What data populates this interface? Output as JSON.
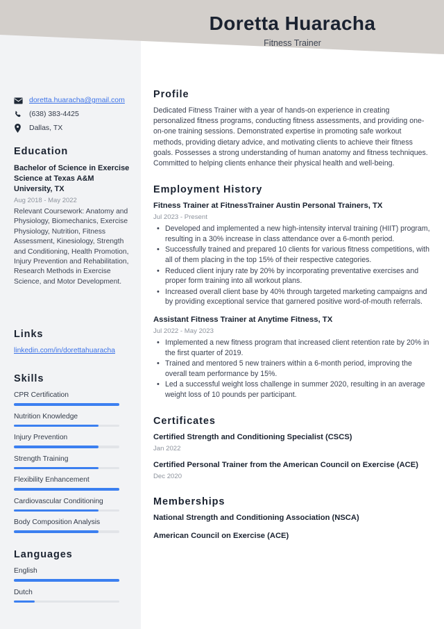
{
  "header": {
    "name": "Doretta Huaracha",
    "job_title": "Fitness Trainer",
    "band_color": "#d3cfcb"
  },
  "theme": {
    "accent": "#3b7ff0",
    "link": "#3b72e8",
    "sidebar_bg": "#f2f3f5",
    "heading": "#1a2230",
    "muted": "#8d939d"
  },
  "sidebar": {
    "contact": {
      "email": "doretta.huaracha@gmail.com",
      "phone": "(638) 383-4425",
      "location": "Dallas, TX"
    },
    "education": {
      "heading": "Education",
      "degree": "Bachelor of Science in Exercise Science at Texas A&M University, TX",
      "date": "Aug 2018 - May 2022",
      "description": "Relevant Coursework: Anatomy and Physiology, Biomechanics, Exercise Physiology, Nutrition, Fitness Assessment, Kinesiology, Strength and Conditioning, Health Promotion, Injury Prevention and Rehabilitation, Research Methods in Exercise Science, and Motor Development."
    },
    "links": {
      "heading": "Links",
      "items": [
        {
          "label": "linkedin.com/in/dorettahuaracha"
        }
      ]
    },
    "skills": {
      "heading": "Skills",
      "items": [
        {
          "label": "CPR Certification",
          "level": 100
        },
        {
          "label": "Nutrition Knowledge",
          "level": 80
        },
        {
          "label": "Injury Prevention",
          "level": 80
        },
        {
          "label": "Strength Training",
          "level": 80
        },
        {
          "label": "Flexibility Enhancement",
          "level": 100
        },
        {
          "label": "Cardiovascular Conditioning",
          "level": 80
        },
        {
          "label": "Body Composition Analysis",
          "level": 80
        }
      ]
    },
    "languages": {
      "heading": "Languages",
      "items": [
        {
          "label": "English",
          "level": 100
        },
        {
          "label": "Dutch",
          "level": 20
        }
      ]
    }
  },
  "main": {
    "profile": {
      "heading": "Profile",
      "text": "Dedicated Fitness Trainer with a year of hands-on experience in creating personalized fitness programs, conducting fitness assessments, and providing one-on-one training sessions. Demonstrated expertise in promoting safe workout methods, providing dietary advice, and motivating clients to achieve their fitness goals. Possesses a strong understanding of human anatomy and fitness techniques. Committed to helping clients enhance their physical health and well-being."
    },
    "employment": {
      "heading": "Employment History",
      "jobs": [
        {
          "title": "Fitness Trainer at FitnessTrainer Austin Personal Trainers, TX",
          "date": "Jul 2023 - Present",
          "bullets": [
            "Developed and implemented a new high-intensity interval training (HIIT) program, resulting in a 30% increase in class attendance over a 6-month period.",
            "Successfully trained and prepared 10 clients for various fitness competitions, with all of them placing in the top 15% of their respective categories.",
            "Reduced client injury rate by 20% by incorporating preventative exercises and proper form training into all workout plans.",
            "Increased overall client base by 40% through targeted marketing campaigns and by providing exceptional service that garnered positive word-of-mouth referrals."
          ]
        },
        {
          "title": "Assistant Fitness Trainer at Anytime Fitness, TX",
          "date": "Jul 2022 - May 2023",
          "bullets": [
            "Implemented a new fitness program that increased client retention rate by 20% in the first quarter of 2019.",
            "Trained and mentored 5 new trainers within a 6-month period, improving the overall team performance by 15%.",
            "Led a successful weight loss challenge in summer 2020, resulting in an average weight loss of 10 pounds per participant."
          ]
        }
      ]
    },
    "certificates": {
      "heading": "Certificates",
      "items": [
        {
          "name": "Certified Strength and Conditioning Specialist (CSCS)",
          "date": "Jan 2022"
        },
        {
          "name": "Certified Personal Trainer from the American Council on Exercise (ACE)",
          "date": "Dec 2020"
        }
      ]
    },
    "memberships": {
      "heading": "Memberships",
      "items": [
        {
          "name": "National Strength and Conditioning Association (NSCA)"
        },
        {
          "name": "American Council on Exercise (ACE)"
        }
      ]
    }
  }
}
